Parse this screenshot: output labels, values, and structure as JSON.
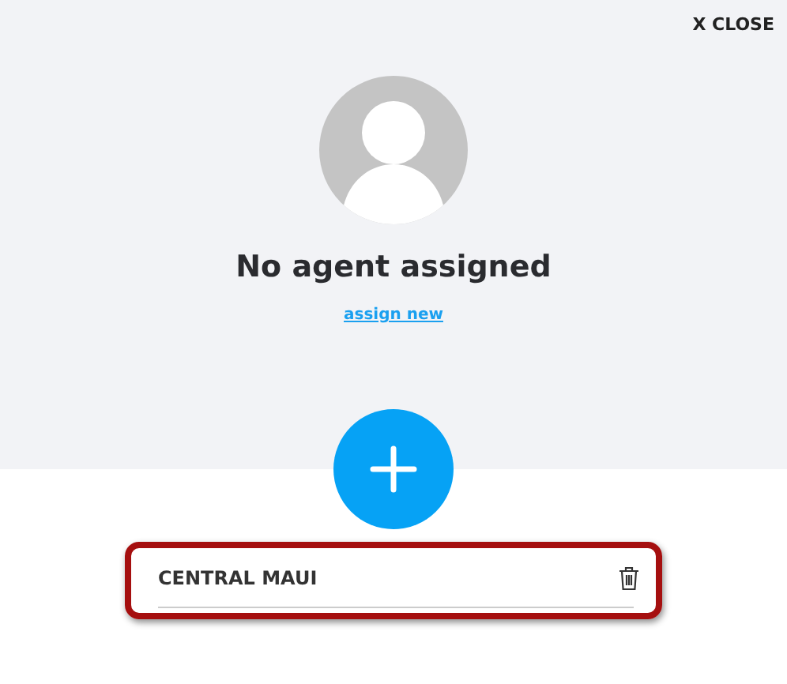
{
  "close_button": {
    "label": "X CLOSE"
  },
  "agent": {
    "title": "No agent assigned",
    "link": "assign new"
  },
  "areas": [
    {
      "name": "CENTRAL MAUI",
      "highlighted": true
    }
  ]
}
